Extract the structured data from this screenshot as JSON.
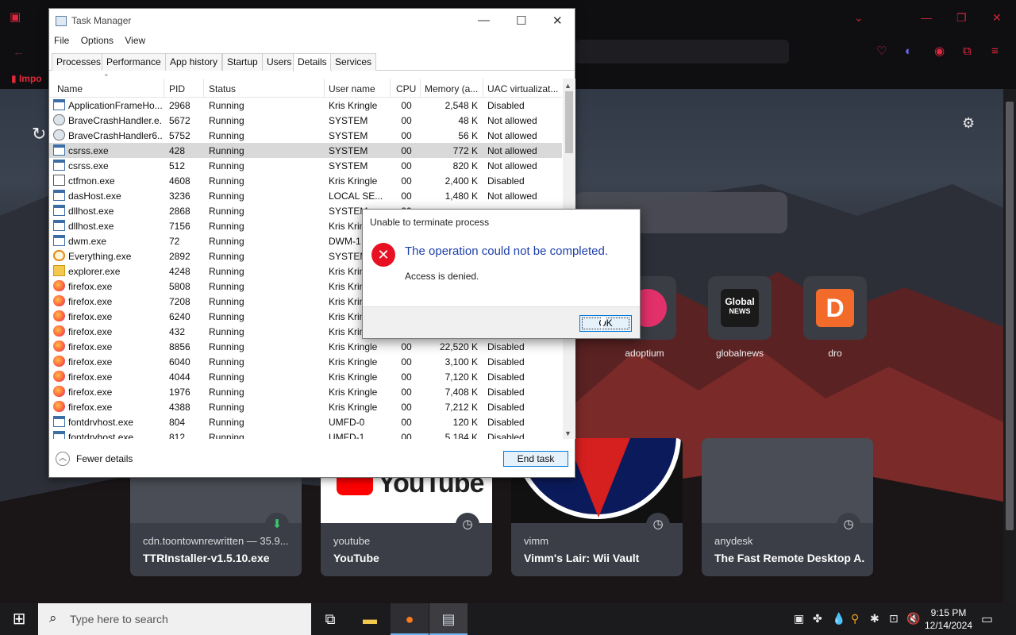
{
  "browser": {
    "bookmark_label": "Impo",
    "shortcuts": [
      {
        "label": "adoptium"
      },
      {
        "label": "globalnews",
        "logo_text_1": "Global",
        "logo_text_2": "NEWS"
      },
      {
        "label": "dro",
        "logo_text": "D"
      }
    ],
    "cards": [
      {
        "subtitle": "cdn.toontownrewritten — 35.9...",
        "title": "TTRInstaller-v1.5.10.exe",
        "badge_icon": "download-icon"
      },
      {
        "subtitle": "youtube",
        "title": "YouTube",
        "thumb_text": "YouTube",
        "badge_icon": "clock-icon"
      },
      {
        "subtitle": "vimm",
        "title": "Vimm's Lair: Wii Vault",
        "badge_icon": "clock-icon"
      },
      {
        "subtitle": "anydesk",
        "title": "The Fast Remote Desktop A...",
        "badge_icon": "clock-icon"
      }
    ],
    "accent_color": "#e0263c"
  },
  "task_manager": {
    "title": "Task Manager",
    "menu": [
      "File",
      "Options",
      "View"
    ],
    "tabs": [
      "Processes",
      "Performance",
      "App history",
      "Startup",
      "Users",
      "Details",
      "Services"
    ],
    "active_tab": "Details",
    "columns": [
      "Name",
      "PID",
      "Status",
      "User name",
      "CPU",
      "Memory (a...",
      "UAC virtualizat..."
    ],
    "rows": [
      {
        "name": "ApplicationFrameHo...",
        "pid": "2968",
        "status": "Running",
        "user": "Kris Kringle",
        "cpu": "00",
        "mem": "2,548 K",
        "uac": "Disabled",
        "icon": "window-icon"
      },
      {
        "name": "BraveCrashHandler.e...",
        "pid": "5672",
        "status": "Running",
        "user": "SYSTEM",
        "cpu": "00",
        "mem": "48 K",
        "uac": "Not allowed",
        "icon": "gear-app-icon"
      },
      {
        "name": "BraveCrashHandler6...",
        "pid": "5752",
        "status": "Running",
        "user": "SYSTEM",
        "cpu": "00",
        "mem": "56 K",
        "uac": "Not allowed",
        "icon": "gear-app-icon"
      },
      {
        "name": "csrss.exe",
        "pid": "428",
        "status": "Running",
        "user": "SYSTEM",
        "cpu": "00",
        "mem": "772 K",
        "uac": "Not allowed",
        "icon": "window-icon",
        "selected": true
      },
      {
        "name": "csrss.exe",
        "pid": "512",
        "status": "Running",
        "user": "SYSTEM",
        "cpu": "00",
        "mem": "820 K",
        "uac": "Not allowed",
        "icon": "window-icon"
      },
      {
        "name": "ctfmon.exe",
        "pid": "4608",
        "status": "Running",
        "user": "Kris Kringle",
        "cpu": "00",
        "mem": "2,400 K",
        "uac": "Disabled",
        "icon": "pen-icon"
      },
      {
        "name": "dasHost.exe",
        "pid": "3236",
        "status": "Running",
        "user": "LOCAL SE...",
        "cpu": "00",
        "mem": "1,480 K",
        "uac": "Not allowed",
        "icon": "window-icon"
      },
      {
        "name": "dllhost.exe",
        "pid": "2868",
        "status": "Running",
        "user": "SYSTEM",
        "cpu": "00",
        "mem": "",
        "uac": "",
        "icon": "window-icon"
      },
      {
        "name": "dllhost.exe",
        "pid": "7156",
        "status": "Running",
        "user": "Kris Krin",
        "cpu": "",
        "mem": "",
        "uac": "",
        "icon": "window-icon"
      },
      {
        "name": "dwm.exe",
        "pid": "72",
        "status": "Running",
        "user": "DWM-1",
        "cpu": "",
        "mem": "",
        "uac": "",
        "icon": "window-icon"
      },
      {
        "name": "Everything.exe",
        "pid": "2892",
        "status": "Running",
        "user": "SYSTEM",
        "cpu": "",
        "mem": "",
        "uac": "",
        "icon": "magnifier-icon"
      },
      {
        "name": "explorer.exe",
        "pid": "4248",
        "status": "Running",
        "user": "Kris Krin",
        "cpu": "",
        "mem": "",
        "uac": "",
        "icon": "folder-icon"
      },
      {
        "name": "firefox.exe",
        "pid": "5808",
        "status": "Running",
        "user": "Kris Krin",
        "cpu": "",
        "mem": "",
        "uac": "",
        "icon": "firefox-icon"
      },
      {
        "name": "firefox.exe",
        "pid": "7208",
        "status": "Running",
        "user": "Kris Krin",
        "cpu": "",
        "mem": "",
        "uac": "",
        "icon": "firefox-icon"
      },
      {
        "name": "firefox.exe",
        "pid": "6240",
        "status": "Running",
        "user": "Kris Krin",
        "cpu": "",
        "mem": "",
        "uac": "",
        "icon": "firefox-icon"
      },
      {
        "name": "firefox.exe",
        "pid": "432",
        "status": "Running",
        "user": "Kris Krin",
        "cpu": "",
        "mem": "",
        "uac": "",
        "icon": "firefox-icon"
      },
      {
        "name": "firefox.exe",
        "pid": "8856",
        "status": "Running",
        "user": "Kris Kringle",
        "cpu": "00",
        "mem": "22,520 K",
        "uac": "Disabled",
        "icon": "firefox-icon"
      },
      {
        "name": "firefox.exe",
        "pid": "6040",
        "status": "Running",
        "user": "Kris Kringle",
        "cpu": "00",
        "mem": "3,100 K",
        "uac": "Disabled",
        "icon": "firefox-icon"
      },
      {
        "name": "firefox.exe",
        "pid": "4044",
        "status": "Running",
        "user": "Kris Kringle",
        "cpu": "00",
        "mem": "7,120 K",
        "uac": "Disabled",
        "icon": "firefox-icon"
      },
      {
        "name": "firefox.exe",
        "pid": "1976",
        "status": "Running",
        "user": "Kris Kringle",
        "cpu": "00",
        "mem": "7,408 K",
        "uac": "Disabled",
        "icon": "firefox-icon"
      },
      {
        "name": "firefox.exe",
        "pid": "4388",
        "status": "Running",
        "user": "Kris Kringle",
        "cpu": "00",
        "mem": "7,212 K",
        "uac": "Disabled",
        "icon": "firefox-icon"
      },
      {
        "name": "fontdrvhost.exe",
        "pid": "804",
        "status": "Running",
        "user": "UMFD-0",
        "cpu": "00",
        "mem": "120 K",
        "uac": "Disabled",
        "icon": "window-icon"
      },
      {
        "name": "fontdrvhost.exe",
        "pid": "812",
        "status": "Running",
        "user": "UMFD-1",
        "cpu": "00",
        "mem": "5,184 K",
        "uac": "Disabled",
        "icon": "window-icon"
      }
    ],
    "fewer_details": "Fewer details",
    "end_task": "End task"
  },
  "dialog": {
    "title": "Unable to terminate process",
    "main": "The operation could not be completed.",
    "sub": "Access is denied.",
    "ok": "OK"
  },
  "taskbar": {
    "search_placeholder": "Type here to search",
    "time": "9:15 PM",
    "date": "12/14/2024"
  }
}
